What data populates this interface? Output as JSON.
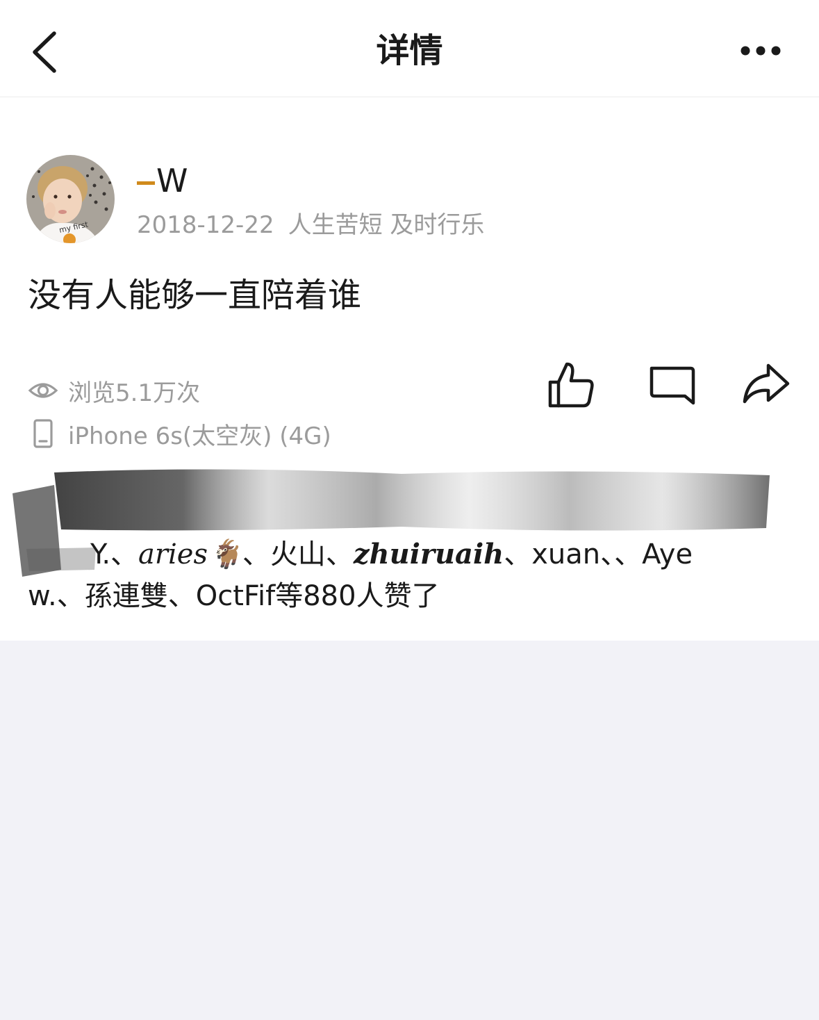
{
  "nav": {
    "title": "详情",
    "back_icon": "chevron-left-icon",
    "more_icon": "more-horizontal-icon"
  },
  "post": {
    "username": "W",
    "date": "2018-12-22",
    "signature": "人生苦短 及时行乐",
    "text": "没有人能够一直陪着谁",
    "views": "浏览5.1万次",
    "device": "iPhone 6s(太空灰) (4G)"
  },
  "actions": {
    "like_icon": "thumbs-up-icon",
    "comment_icon": "comment-icon",
    "share_icon": "share-arrow-icon"
  },
  "likes": {
    "line1_names": [
      "Y.",
      "aries🐐",
      "火山",
      "zhuiruaih",
      "xuan",
      "",
      "Aye"
    ],
    "line2_names": [
      "w.",
      "孫連雙",
      "OctFif"
    ],
    "suffix": "等880人赞了"
  },
  "colors": {
    "background": "#f2f2f7",
    "card": "#ffffff",
    "secondary_text": "#9b9b9b",
    "primary_text": "#1a1a1a"
  }
}
